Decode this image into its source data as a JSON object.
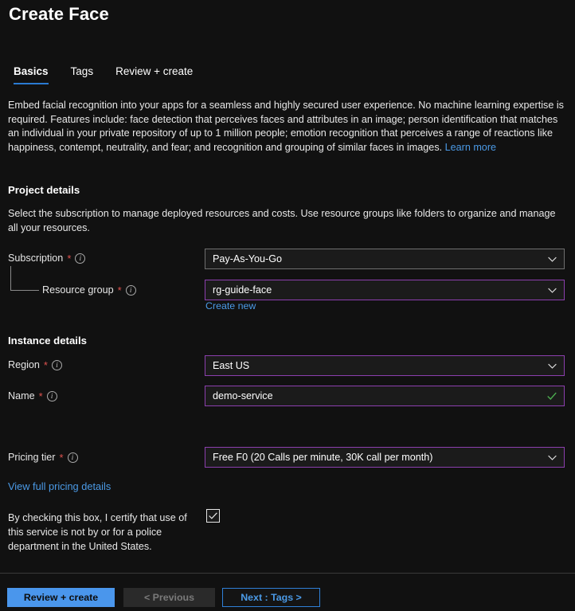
{
  "page": {
    "title": "Create Face"
  },
  "tabs": [
    {
      "label": "Basics",
      "active": true
    },
    {
      "label": "Tags",
      "active": false
    },
    {
      "label": "Review + create",
      "active": false
    }
  ],
  "description": {
    "body": "Embed facial recognition into your apps for a seamless and highly secured user experience. No machine learning expertise is required. Features include: face detection that perceives faces and attributes in an image; person identification that matches an individual in your private repository of up to 1 million people; emotion recognition that perceives a range of reactions like happiness, contempt, neutrality, and fear; and recognition and grouping of similar faces in images. ",
    "learn_more": "Learn more"
  },
  "project_details": {
    "heading": "Project details",
    "subtext": "Select the subscription to manage deployed resources and costs. Use resource groups like folders to organize and manage all your resources.",
    "subscription": {
      "label": "Subscription",
      "required": "*",
      "value": "Pay-As-You-Go"
    },
    "resource_group": {
      "label": "Resource group",
      "required": "*",
      "value": "rg-guide-face",
      "create_new": "Create new"
    }
  },
  "instance_details": {
    "heading": "Instance details",
    "region": {
      "label": "Region",
      "required": "*",
      "value": "East US"
    },
    "name": {
      "label": "Name",
      "required": "*",
      "value": "demo-service"
    },
    "pricing_tier": {
      "label": "Pricing tier",
      "required": "*",
      "value": "Free F0 (20 Calls per minute, 30K call per month)"
    },
    "pricing_link": "View full pricing details"
  },
  "certification": {
    "text": "By checking this box, I certify that use of this service is not by or for a police department in the United States.",
    "checked": true
  },
  "footer": {
    "review_create": "Review + create",
    "previous": "< Previous",
    "next": "Next : Tags >"
  },
  "colors": {
    "background": "#111111",
    "accent_blue": "#4b9ae6",
    "tab_underline": "#2a7ad2",
    "field_border_focus": "#8c3fae",
    "field_border": "#6f6f6f",
    "required_asterisk": "#e0534f",
    "valid_check": "#4caf50",
    "primary_button": "#4a96ec"
  }
}
